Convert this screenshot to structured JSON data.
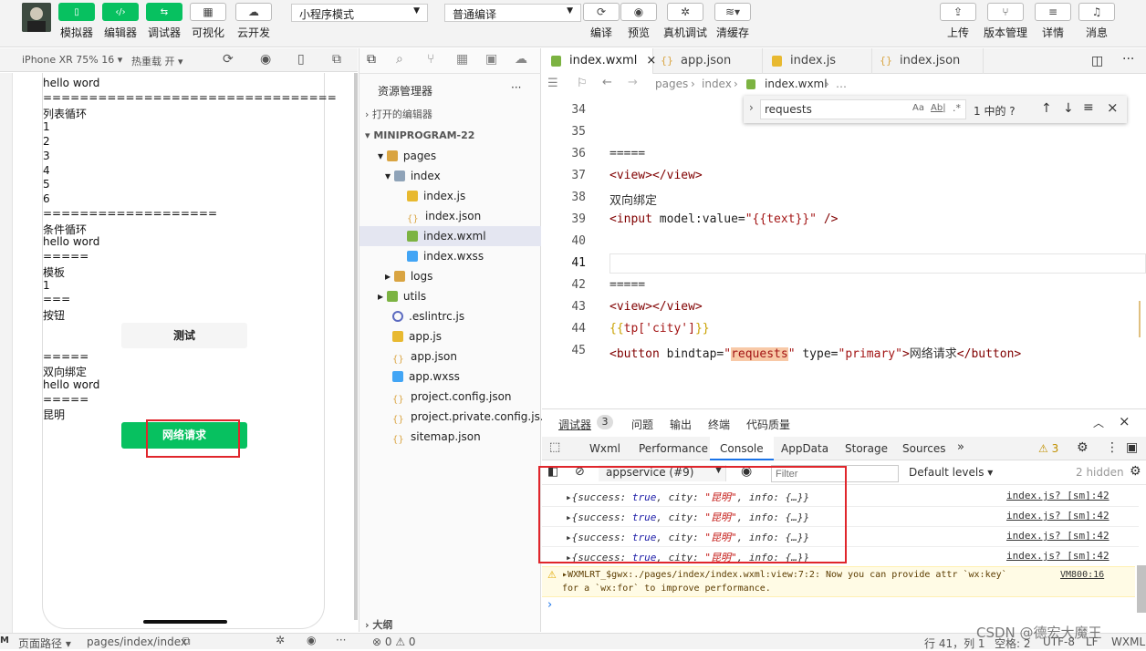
{
  "toolbar": {
    "buttons_left": [
      {
        "label": "模拟器",
        "glyph": "▯"
      },
      {
        "label": "编辑器",
        "glyph": "‹/›"
      },
      {
        "label": "调试器",
        "glyph": "⇆"
      },
      {
        "label": "可视化",
        "glyph": "▦"
      },
      {
        "label": "云开发",
        "glyph": "☁"
      }
    ],
    "mode_select": "小程序模式",
    "compile_select": "普通编译",
    "buttons_mid": [
      {
        "label": "编译",
        "glyph": "⟳"
      },
      {
        "label": "预览",
        "glyph": "◉"
      },
      {
        "label": "真机调试",
        "glyph": "✲"
      },
      {
        "label": "清缓存",
        "glyph": "≋▾"
      }
    ],
    "buttons_right": [
      {
        "label": "上传",
        "glyph": "⇪"
      },
      {
        "label": "版本管理",
        "glyph": "⑂"
      },
      {
        "label": "详情",
        "glyph": "≡"
      },
      {
        "label": "消息",
        "glyph": "♫"
      }
    ]
  },
  "simulator": {
    "device": "iPhone XR 75% 16 ▾",
    "hot_reload": "热重载 开 ▾",
    "lines": [
      "hello word",
      "================================",
      "列表循环",
      "1",
      "2",
      "3",
      "4",
      "5",
      "6",
      "===================",
      "条件循环",
      "hello word",
      "=====",
      "模板",
      "1",
      "===",
      "按钮"
    ],
    "test_button": "测试",
    "lines2": [
      "=====",
      "双向绑定",
      "hello word",
      "=====",
      "昆明"
    ],
    "net_button": "网络请求"
  },
  "explorer": {
    "title": "资源管理器",
    "more": "···",
    "open_editors": "打开的编辑器",
    "project": "MINIPROGRAM-22",
    "items": [
      {
        "label": "pages",
        "type": "folder"
      },
      {
        "label": "index",
        "type": "folder"
      },
      {
        "label": "index.js",
        "type": "js"
      },
      {
        "label": "index.json",
        "type": "json"
      },
      {
        "label": "index.wxml",
        "type": "wxml"
      },
      {
        "label": "index.wxss",
        "type": "wxss"
      },
      {
        "label": "logs",
        "type": "folder"
      },
      {
        "label": "utils",
        "type": "folder"
      },
      {
        "label": ".eslintrc.js",
        "type": "eslint"
      },
      {
        "label": "app.js",
        "type": "js"
      },
      {
        "label": "app.json",
        "type": "json"
      },
      {
        "label": "app.wxss",
        "type": "wxss"
      },
      {
        "label": "project.config.json",
        "type": "json"
      },
      {
        "label": "project.private.config.js...",
        "type": "json"
      },
      {
        "label": "sitemap.json",
        "type": "json"
      }
    ],
    "outline": "大纲"
  },
  "editor": {
    "tabs": [
      "index.wxml",
      "app.json",
      "index.js",
      "index.json"
    ],
    "close_glyph": "×",
    "breadcrumb": {
      "seg1": "pages",
      "sep": "›",
      "seg2": "index",
      "file": "index.wxml",
      "tail": "…"
    },
    "find": {
      "query": "requests",
      "opt_case": "Aa",
      "opt_word": "Ab|",
      "opt_regex": ".*",
      "result": "1 中的 ?"
    },
    "line_numbers": [
      "34",
      "35",
      "36",
      "37",
      "38",
      "39",
      "40",
      "41",
      "42",
      "43",
      "44",
      "45"
    ],
    "code": {
      "l36": "=====",
      "l37": "<view></view>",
      "l38": "双向绑定",
      "l39": {
        "open": "<input ",
        "attr": "model:value=",
        "val": "\"{{text}}\"",
        "close": " />"
      },
      "l42": "=====",
      "l43": "<view></view>",
      "l44": {
        "open": "{{",
        "val": "tp['city']",
        "close": "}}"
      },
      "l45": {
        "open": "<button ",
        "attr1": "bindtap=",
        "q1": "\"",
        "hl": "requests",
        "q2": "\"",
        "attr2": " type=",
        "val2": "\"primary\"",
        "gt": ">",
        "text": "网络请求",
        "end": "</button>"
      }
    }
  },
  "devtools": {
    "tabs": [
      "调试器",
      "问题",
      "输出",
      "终端",
      "代码质量"
    ],
    "badge": "3",
    "subtabs": [
      "Wxml",
      "Performance",
      "Console",
      "AppData",
      "Storage",
      "Sources"
    ],
    "more_tabs": "»",
    "warn_count": "⚠ 3",
    "context": "appservice (#9)",
    "filter_placeholder": "Filter",
    "levels": "Default levels ▾",
    "hidden": "2 hidden",
    "logs": [
      {
        "pre": "▸{success: ",
        "t": "true",
        "mid": ", city: ",
        "s": "\"昆明\"",
        "post": ", info: {…}}",
        "src": "index.js? [sm]:42"
      },
      {
        "pre": "▸{success: ",
        "t": "true",
        "mid": ", city: ",
        "s": "\"昆明\"",
        "post": ", info: {…}}",
        "src": "index.js? [sm]:42"
      },
      {
        "pre": "▸{success: ",
        "t": "true",
        "mid": ", city: ",
        "s": "\"昆明\"",
        "post": ", info: {…}}",
        "src": "index.js? [sm]:42"
      },
      {
        "pre": "▸{success: ",
        "t": "true",
        "mid": ", city: ",
        "s": "\"昆明\"",
        "post": ", info: {…}}",
        "src": "index.js? [sm]:42"
      }
    ],
    "warning_line1": "▸WXMLRT_$gwx:./pages/index/index.wxml:view:7:2: Now you can provide attr `wx:key`",
    "warning_line2": "for a `wx:for` to improve performance.",
    "warning_src": "VM800:16",
    "prompt": "›"
  },
  "statusbar": {
    "page_path": "页面路径 ▾",
    "path": "pages/index/index",
    "problems": "⊗ 0 ⚠ 0",
    "position": "行 41，列 1",
    "spaces": "空格: 2",
    "encoding": "UTF-8",
    "eol": "LF",
    "lang": "WXML",
    "watermark": "CSDN @德宏大魔王"
  },
  "colors": {
    "accent_green": "#07c160",
    "highlight_box": "#e0262c",
    "find_match": "#f8c9a7"
  }
}
